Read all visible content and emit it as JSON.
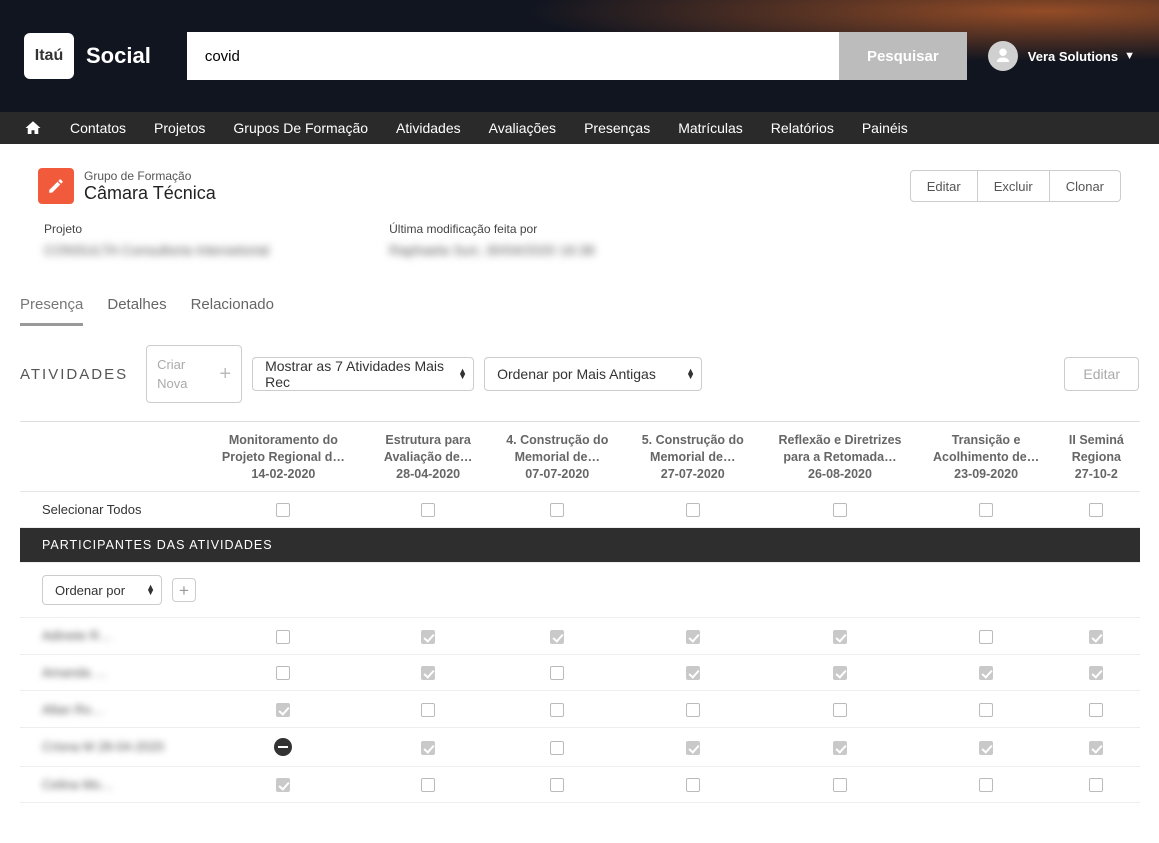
{
  "header": {
    "logo_text": "Itaú",
    "logo_social": "Social",
    "search_value": "covid",
    "search_button": "Pesquisar",
    "user_name": "Vera Solutions"
  },
  "nav": [
    "Contatos",
    "Projetos",
    "Grupos De Formação",
    "Atividades",
    "Avaliações",
    "Presenças",
    "Matrículas",
    "Relatórios",
    "Painéis"
  ],
  "record": {
    "object_label": "Grupo de Formação",
    "name": "Câmara Técnica",
    "actions": {
      "edit": "Editar",
      "delete": "Excluir",
      "clone": "Clonar"
    }
  },
  "details": {
    "project_label": "Projeto",
    "project_value": "CONSULTA Consultoria Intersetorial",
    "modified_label": "Última modificação feita por",
    "modified_value": "Raphaela Suri, 30/04/2020 16:38"
  },
  "tabs": {
    "presence": "Presença",
    "details": "Detalhes",
    "related": "Relacionado"
  },
  "activities_bar": {
    "title": "ATIVIDADES",
    "create": "Criar",
    "new": "Nova",
    "show_select": "Mostrar as 7 Atividades Mais Rec",
    "sort_select": "Ordenar por Mais Antigas",
    "edit": "Editar"
  },
  "columns": [
    {
      "title": "Monitoramento do Projeto Regional d…",
      "date": "14-02-2020"
    },
    {
      "title": "Estrutura para Avaliação de…",
      "date": "28-04-2020"
    },
    {
      "title": "4. Construção do Memorial de…",
      "date": "07-07-2020"
    },
    {
      "title": "5. Construção do Memorial de…",
      "date": "27-07-2020"
    },
    {
      "title": "Reflexão e Diretrizes para a Retomada…",
      "date": "26-08-2020"
    },
    {
      "title": "Transição e Acolhimento de…",
      "date": "23-09-2020"
    },
    {
      "title": "II Seminá Regiona",
      "date": "27-10-2"
    }
  ],
  "select_all": "Selecionar Todos",
  "section_header": "PARTICIPANTES DAS ATIVIDADES",
  "sort_small": "Ordenar por",
  "rows": [
    {
      "name": "Adinete R…",
      "cells": [
        "empty",
        "check",
        "check",
        "check",
        "check",
        "empty",
        "check"
      ]
    },
    {
      "name": "Amanda …",
      "cells": [
        "empty",
        "check",
        "empty",
        "check",
        "check",
        "check",
        "check"
      ]
    },
    {
      "name": "Allan Ro…",
      "cells": [
        "check",
        "empty",
        "empty",
        "empty",
        "empty",
        "empty",
        "empty"
      ]
    },
    {
      "name": "Crisna M 28-04-2020",
      "cells": [
        "minus",
        "check",
        "empty",
        "check",
        "check",
        "check",
        "check"
      ]
    },
    {
      "name": "Celina Mo…",
      "cells": [
        "check",
        "empty",
        "empty",
        "empty",
        "empty",
        "empty",
        "empty"
      ]
    }
  ]
}
